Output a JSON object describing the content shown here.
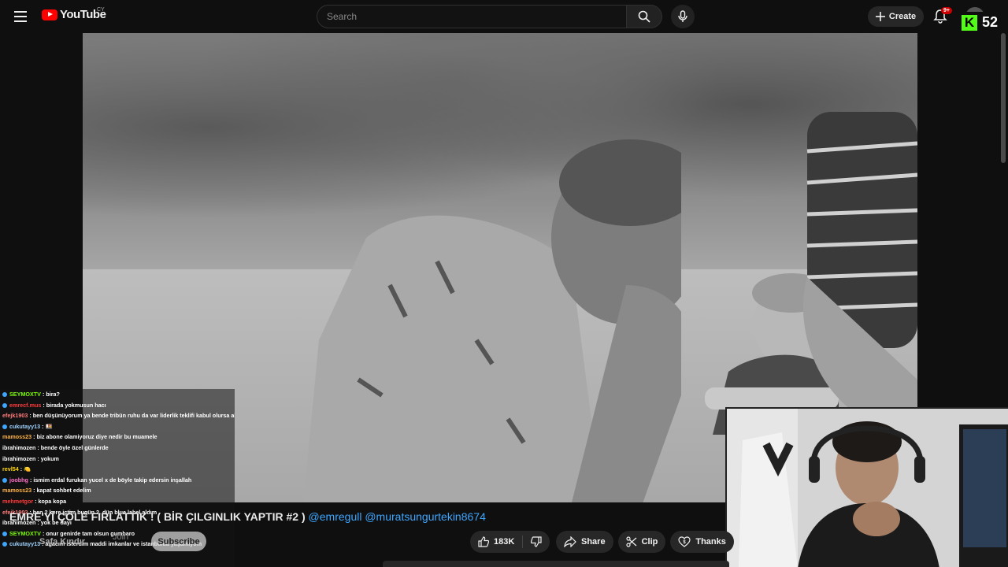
{
  "header": {
    "logo_text": "YouTube",
    "country_code": "CY",
    "search_placeholder": "Search",
    "create_label": "Create",
    "notification_count": "9+"
  },
  "overlay": {
    "kick_letter": "K",
    "kick_number": "52"
  },
  "chat": [
    {
      "user": "SEYMOXTV",
      "color": "#7cfc00",
      "badge": "#3ea6ff",
      "text": "bira?"
    },
    {
      "user": "emrecf.mus",
      "color": "#ff3b3b",
      "badge": "#3ea6ff",
      "text": "birada yokmusun hacı"
    },
    {
      "user": "efejk1903",
      "color": "#ff7a7a",
      "badge": "",
      "text": "ben düşünüyorum ya bende tribün ruhu da var liderlik teklifi kabul olursa alcam"
    },
    {
      "user": "cukutayy13",
      "color": "#9fd3ff",
      "badge": "#3ea6ff",
      "text": "🍱"
    },
    {
      "user": "mamoss23",
      "color": "#ffb347",
      "badge": "",
      "text": "biz abone olamiyoruz diye nedir bu muamele"
    },
    {
      "user": "ibrahimozen",
      "color": "#ffffff",
      "badge": "",
      "text": "bende öyle özel günlerde"
    },
    {
      "user": "ibrahimozen",
      "color": "#ffffff",
      "badge": "",
      "text": "yokum"
    },
    {
      "user": "revl54",
      "color": "#ffd700",
      "badge": "",
      "text": "🍋"
    },
    {
      "user": "joobhg",
      "color": "#ff6ec7",
      "badge": "#3ea6ff",
      "text": "ismim erdal furukan yucel x de böyle takip edersin inşallah"
    },
    {
      "user": "mamoss23",
      "color": "#ffb347",
      "badge": "",
      "text": "kapat sohbet edelim"
    },
    {
      "user": "mehmetgor",
      "color": "#ff3b3b",
      "badge": "",
      "text": "kopa kopa"
    },
    {
      "user": "efejk1903",
      "color": "#ff7a7a",
      "badge": "",
      "text": "ben 2 kere içtim bugün 2. dün blue label aldım"
    },
    {
      "user": "ibrahimozen",
      "color": "#ffffff",
      "badge": "",
      "text": "yok be dayı"
    },
    {
      "user": "SEYMOXTV",
      "color": "#7cfc00",
      "badge": "#3ea6ff",
      "text": "onur genirde tam olsun gumbaro"
    },
    {
      "user": "cukutayy13",
      "color": "#9fd3ff",
      "badge": "#3ea6ff",
      "text": "agacım isterdim maddi imkanlar ve istanbulda yaşamıyom"
    }
  ],
  "video": {
    "title_main": "EMRE'Yİ ÇÖLE FIRLATTIK ! ( BİR ÇILGINLIK YAPTIR #2 )",
    "mention_1": "@emregull",
    "mention_2": "@muratsungurtekin8674",
    "channel_name": "Safa Kındır",
    "join_label": "Join",
    "subscribe_label": "Subscribe",
    "like_count": "183K",
    "share_label": "Share",
    "clip_label": "Clip",
    "thanks_label": "Thanks"
  },
  "colors": {
    "background": "#0f0f0f",
    "accent_red": "#ff0000",
    "kick_green": "#53fc18",
    "link_blue": "#3ea6ff"
  }
}
